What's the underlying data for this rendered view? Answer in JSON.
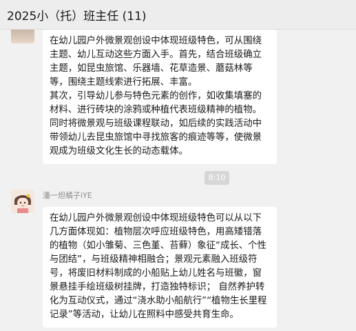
{
  "window": {
    "title": "2025小（托）班主任 (11)"
  },
  "messages": [
    {
      "paragraphs": [
        "在幼儿园户外微景观创设中体现班级特色，可从围绕主题、幼儿互动这些方面入手。首先，结合班级确立主题，如昆虫旅馆、乐器墙、花草造景、蘑菇林等等，围绕主题线索进行拓展、丰富。",
        "其次，引导幼儿参与特色元素的创作，如收集填塞的材料、进行砖块的涂鸦或种植代表班级精神的植物。同时将微景观与班级课程联动，如后续的实践活动中带领幼儿去昆虫旅馆中寻找旅客的痕迹等等，使微景观成为班级文化生长的动态载体。"
      ]
    },
    {
      "timestamp": "8:10",
      "sender": "潘一炟橘子iYE",
      "text": "在幼儿园户外微景观创设中体现班级特色可以从以下几方面体现如：植物层次呼应班级特色，用高矮错落的植物（如小雏菊、三色堇、苔藓）象征“成长、个性与团结”，与班级精神相融合；景观元素融入班级符号，将废旧材料制成的小船贴上幼儿姓名与班徽，窗景悬挂手绘班级树挂牌，打造独特标识； 自然养护转化为互动仪式，通过“浇水助小船航行”“植物生长里程记录”等活动，让幼儿在照料中感受共育生命。"
    }
  ]
}
